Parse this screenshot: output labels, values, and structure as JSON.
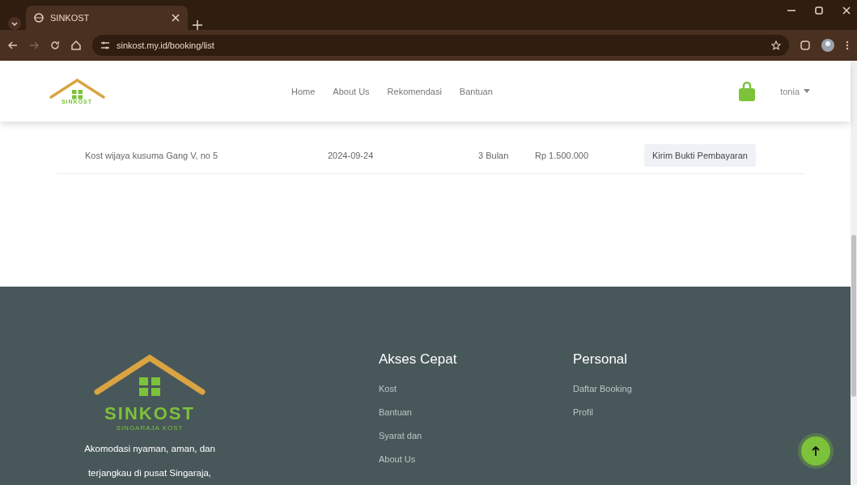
{
  "browser": {
    "tab_title": "SINKOST",
    "url": "sinkost.my.id/booking/list"
  },
  "header": {
    "logo_text": "SINKOST",
    "nav": [
      "Home",
      "About Us",
      "Rekomendasi",
      "Bantuan"
    ],
    "user": "tonia"
  },
  "bookings": [
    {
      "name": "Kost wijaya kusuma Gang V, no 5",
      "date": "2024-09-24",
      "duration": "3 Bulan",
      "price": "Rp 1.500.000",
      "action": "Kirim Bukti Pembayaran"
    }
  ],
  "footer": {
    "logo_text": "SINKOST",
    "logo_subtitle": "SINGARAJA KOST",
    "description_lines": [
      "Akomodasi nyaman, aman, dan",
      "terjangkau di pusat Singaraja,"
    ],
    "columns": [
      {
        "title": "Akses Cepat",
        "links": [
          "Kost",
          "Bantuan",
          "Syarat dan",
          "About Us"
        ]
      },
      {
        "title": "Personal",
        "links": [
          "Daftar Booking",
          "Profil"
        ]
      }
    ]
  }
}
